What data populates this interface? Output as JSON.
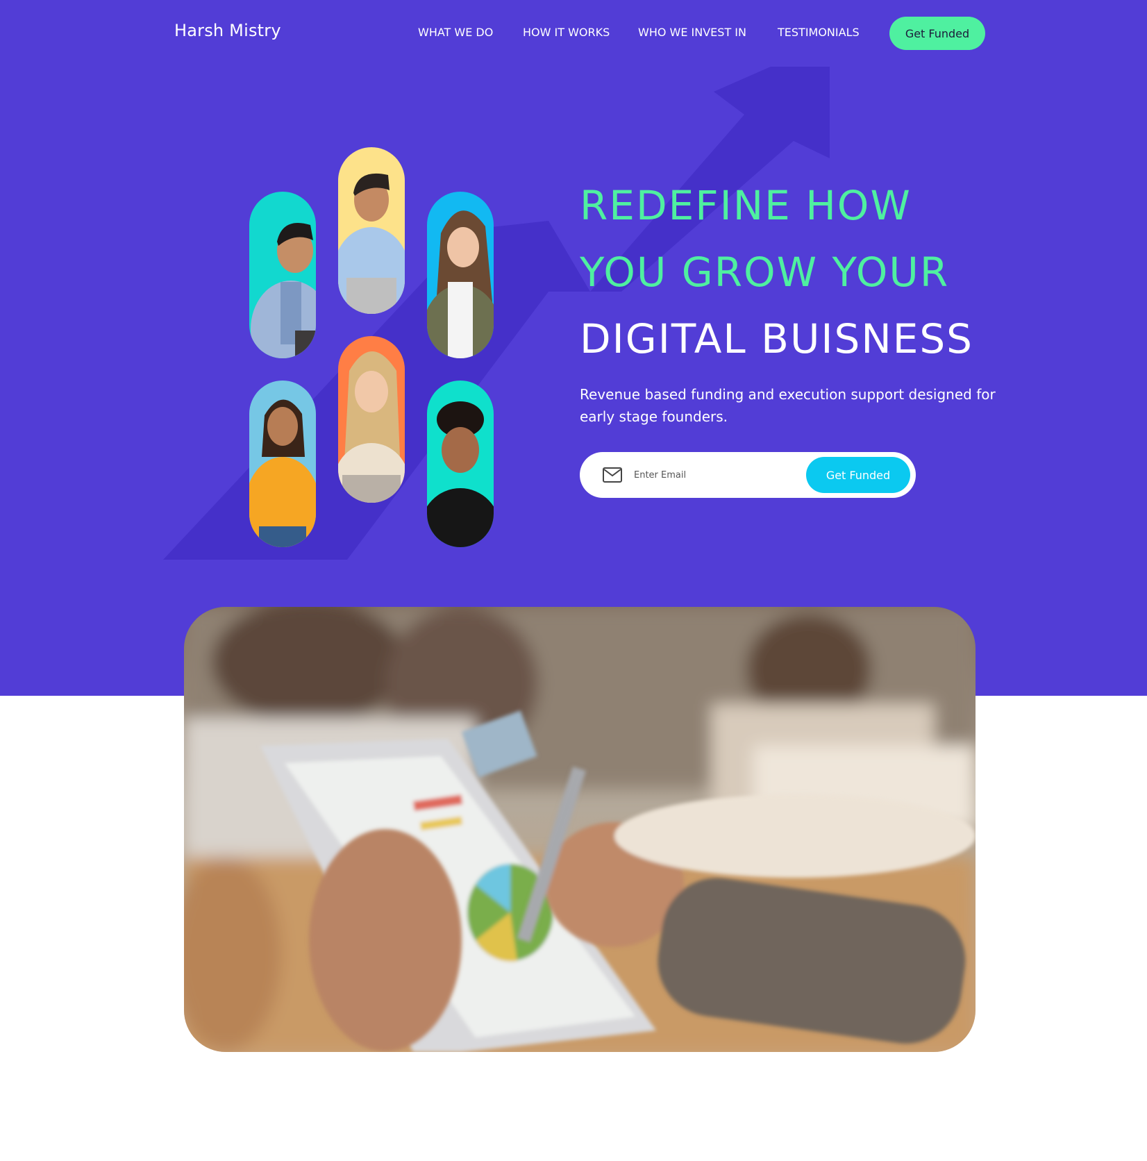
{
  "header": {
    "brand": "Harsh Mistry",
    "nav": [
      "WHAT WE DO",
      "HOW IT WORKS",
      "WHO WE INVEST IN",
      "TESTIMONIALS"
    ],
    "cta_label": "Get Funded"
  },
  "hero": {
    "headline_line1": "REDEFINE HOW",
    "headline_line2": "YOU GROW YOUR",
    "headline_line3": "DIGITAL BUISNESS",
    "subtitle": "Revenue based funding and execution support designed for early stage founders.",
    "email_placeholder": "Enter Email",
    "email_button": "Get Funded"
  },
  "colors": {
    "hero_background": "#523dd6",
    "accent_green": "#4ff0a0",
    "accent_cyan": "#0bc9f0",
    "arrow_shade": "#4530c9"
  },
  "icons": [
    "mail-icon",
    "growth-arrow-graphic"
  ]
}
